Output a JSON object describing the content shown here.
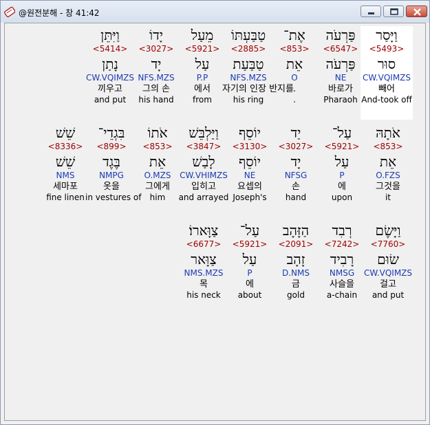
{
  "window": {
    "title": "@원전분해 - 창 41:42",
    "icon": "app-scroll-icon"
  },
  "rows": [
    [
      {
        "heb": "וַיָּסַר",
        "strong": "<5493>",
        "lemma": "סוּר",
        "parse": "CW.VQIMZS",
        "kor": "빼어",
        "eng": "And-took off",
        "selected": true
      },
      {
        "heb": "פַּרְעֹה",
        "strong": "<6547>",
        "lemma": "פַּרְעֹה",
        "parse": "NE",
        "kor": "바로가",
        "eng": "Pharaoh"
      },
      {
        "heb": "אֶת־",
        "strong": "<853>",
        "lemma": "אֵת",
        "parse": "O",
        "kor": ".",
        "eng": "."
      },
      {
        "heb": "טַבַּעְתּוֹ",
        "strong": "<2885>",
        "lemma": "טַבַּעַת",
        "parse": "NFS.MZS",
        "kor": "자기의 인장 반지를",
        "eng": "his ring"
      },
      {
        "heb": "מֵעַל",
        "strong": "<5921>",
        "lemma": "עַל",
        "parse": "P.P",
        "kor": "에서",
        "eng": "from"
      },
      {
        "heb": "יָדוֹ",
        "strong": "<3027>",
        "lemma": "יָד",
        "parse": "NFS.MZS",
        "kor": "그의 손",
        "eng": "his hand"
      },
      {
        "heb": "וַיִּתֵּן",
        "strong": "<5414>",
        "lemma": "נָתַן",
        "parse": "CW.VQIMZS",
        "kor": "끼우고",
        "eng": "and put"
      }
    ],
    [
      {
        "heb": "אֹתָהּ",
        "strong": "<853>",
        "lemma": "אֵת",
        "parse": "O.FZS",
        "kor": "그것을",
        "eng": "it"
      },
      {
        "heb": "עַל־",
        "strong": "<5921>",
        "lemma": "עַל",
        "parse": "P",
        "kor": "에",
        "eng": "upon"
      },
      {
        "heb": "יַד",
        "strong": "<3027>",
        "lemma": "יָד",
        "parse": "NFSG",
        "kor": "손",
        "eng": "hand"
      },
      {
        "heb": "יוֹסֵף",
        "strong": "<3130>",
        "lemma": "יוֹסֵף",
        "parse": "NE",
        "kor": "요셉의",
        "eng": "Joseph's"
      },
      {
        "heb": "וַיַּלְבֵּשׁ",
        "strong": "<3847>",
        "lemma": "לָבַשׁ",
        "parse": "CW.VHIMZS",
        "kor": "입히고",
        "eng": "and arrayed"
      },
      {
        "heb": "אֹתוֹ",
        "strong": "<853>",
        "lemma": "אֵת",
        "parse": "O.MZS",
        "kor": "그에게",
        "eng": "him"
      },
      {
        "heb": "בִּגְדֵי־",
        "strong": "<899>",
        "lemma": "בֶּגֶד",
        "parse": "NMPG",
        "kor": "옷을",
        "eng": "in vestures of"
      },
      {
        "heb": "שֵׁשׁ",
        "strong": "<8336>",
        "lemma": "שֵׁשׁ",
        "parse": "NMS",
        "kor": "세마포",
        "eng": "fine linen"
      }
    ],
    [
      {
        "heb": "וַיָּשֶׂם",
        "strong": "<7760>",
        "lemma": "שׂוּם",
        "parse": "CW.VQIMZS",
        "kor": "걸고",
        "eng": "and put"
      },
      {
        "heb": "רְבִד",
        "strong": "<7242>",
        "lemma": "רָבִיד",
        "parse": "NMSG",
        "kor": "사슬을",
        "eng": "a-chain"
      },
      {
        "heb": "הַזָּהָב",
        "strong": "<2091>",
        "lemma": "זָהָב",
        "parse": "D.NMS",
        "kor": "금",
        "eng": "gold"
      },
      {
        "heb": "עַל־",
        "strong": "<5921>",
        "lemma": "עַל",
        "parse": "P",
        "kor": "에",
        "eng": "about"
      },
      {
        "heb": "צַוָּארוֹ׃",
        "strong": "<6677>",
        "lemma": "צַוָּאר",
        "parse": "NMS.MZS",
        "kor": "목",
        "eng": "his neck"
      }
    ]
  ]
}
